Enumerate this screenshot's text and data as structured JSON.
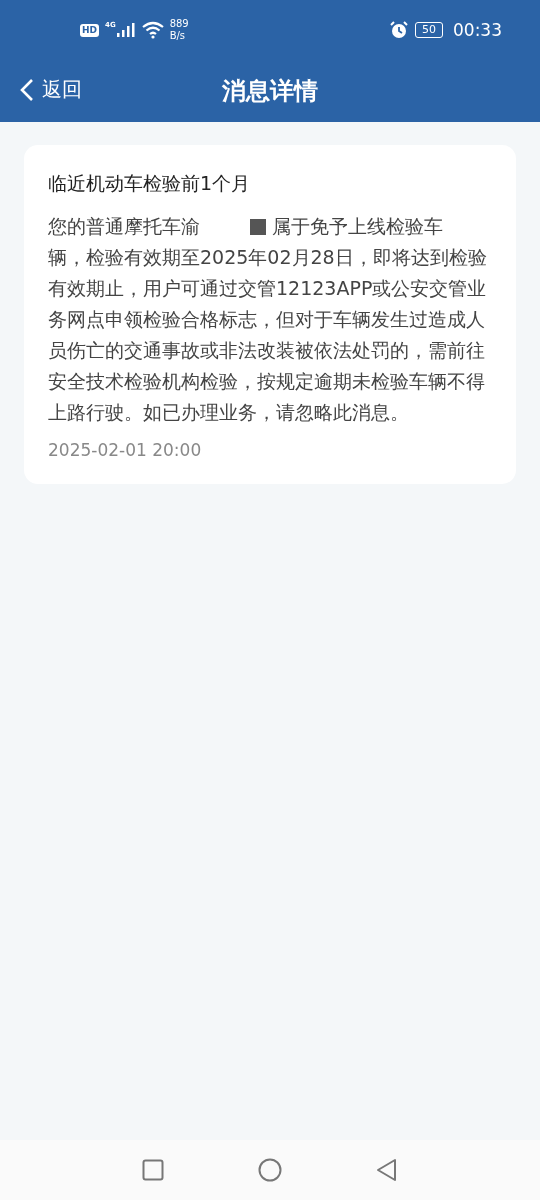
{
  "status_bar": {
    "hd_badge": "HD",
    "network": "4G",
    "speed_value": "889",
    "speed_unit": "B/s",
    "battery": "50",
    "time": "00:33"
  },
  "header": {
    "back_label": "返回",
    "title": "消息详情"
  },
  "message": {
    "title": "临近机动车检验前1个月",
    "body_before": "您的普通摩托车渝",
    "redacted": true,
    "body_after_line": "属于免予上线检验车",
    "body_rest": "辆，检验有效期至2025年02月28日，即将达到检验有效期止，用户可通过交管12123APP或公安交管业务网点申领检验合格标志，但对于车辆发生过造成人员伤亡的交通事故或非法改装被依法处罚的，需前往安全技术检验机构检验，按规定逾期未检验车辆不得上路行驶。如已办理业务，请忽略此消息。",
    "time": "2025-02-01 20:00"
  }
}
